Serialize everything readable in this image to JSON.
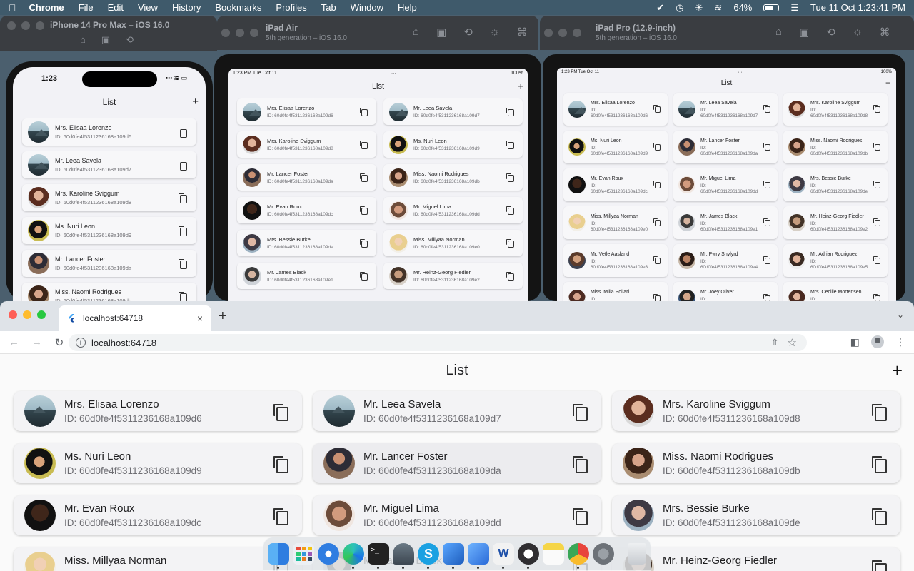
{
  "menubar": {
    "apple": "",
    "items": [
      "Chrome",
      "File",
      "Edit",
      "View",
      "History",
      "Bookmarks",
      "Profiles",
      "Tab",
      "Window",
      "Help"
    ],
    "battery": "64%",
    "datetime": "Tue 11 Oct  1:23:41 PM"
  },
  "simulators": {
    "iphone": {
      "name": "iPhone 14 Pro Max – iOS 16.0",
      "time": "1:23",
      "title": "List",
      "add": "+"
    },
    "ipad_air": {
      "name": "iPad Air",
      "sub": "5th generation – iOS 16.0",
      "time": "1:23 PM  Tue Oct 11",
      "battery": "100%",
      "title": "List",
      "add": "+"
    },
    "ipad_pro": {
      "name": "iPad Pro (12.9-inch)",
      "sub": "5th generation – iOS 16.0",
      "time": "1:23 PM  Tue Oct 11",
      "battery": "100%",
      "title": "List",
      "add": "+"
    }
  },
  "browser": {
    "tab_title": "localhost:64718",
    "tab_close": "×",
    "new_tab": "+",
    "url": "localhost:64718",
    "back": "←",
    "forward": "→",
    "reload": "↻"
  },
  "app": {
    "title": "List",
    "add_label": "+"
  },
  "people": [
    {
      "name": "Mrs. Elisaa Lorenzo",
      "id": "ID: 60d0fe4f5311236168a109d6",
      "avatar": "mountain-photo"
    },
    {
      "name": "Mr. Leea Savela",
      "id": "ID: 60d0fe4f5311236168a109d7",
      "avatar": "mountain-photo"
    },
    {
      "name": "Mrs. Karoline Sviggum",
      "id": "ID: 60d0fe4f5311236168a109d8",
      "avatar": "person-photo"
    },
    {
      "name": "Ms. Nuri Leon",
      "id": "ID: 60d0fe4f5311236168a109d9",
      "avatar": "person-photo"
    },
    {
      "name": "Mr. Lancer Foster",
      "id": "ID: 60d0fe4f5311236168a109da",
      "avatar": "person-photo"
    },
    {
      "name": "Miss. Naomi Rodrigues",
      "id": "ID: 60d0fe4f5311236168a109db",
      "avatar": "person-photo"
    },
    {
      "name": "Mr. Evan Roux",
      "id": "ID: 60d0fe4f5311236168a109dc",
      "avatar": "person-photo"
    },
    {
      "name": "Mr. Miguel Lima",
      "id": "ID: 60d0fe4f5311236168a109dd",
      "avatar": "person-photo"
    },
    {
      "name": "Mrs. Bessie Burke",
      "id": "ID: 60d0fe4f5311236168a109de",
      "avatar": "person-photo"
    },
    {
      "name": "Miss. Millyaa Norman",
      "id": "ID: 60d0fe4f5311236168a109e0",
      "avatar": "person-photo"
    },
    {
      "name": "Mr. James Black",
      "id": "ID: 60d0fe4f5311236168a109e1",
      "avatar": "person-photo"
    },
    {
      "name": "Mr. Heinz-Georg Fiedler",
      "id": "ID: 60d0fe4f5311236168a109e2",
      "avatar": "person-photo"
    },
    {
      "name": "Mr. Vetle Aasland",
      "id": "ID: 60d0fe4f5311236168a109e3",
      "avatar": "person-photo"
    },
    {
      "name": "Mr. Pwry Shylyrd",
      "id": "ID: 60d0fe4f5311236168a109e4",
      "avatar": "person-photo"
    },
    {
      "name": "Mr. Adrian Rodriguez",
      "id": "ID: 60d0fe4f5311236168a109e5",
      "avatar": "person-photo"
    },
    {
      "name": "Miss. Milla Pollari",
      "id": "ID: 60d0fe4f5311236168a109e6",
      "avatar": "person-photo"
    },
    {
      "name": "Mr. Joey Oliver",
      "id": "ID: 60d0fe4f5311236168a109e7",
      "avatar": "person-photo"
    },
    {
      "name": "Mrs. Cecilie Mortensen",
      "id": "ID: 60d0fe4f5311236168a109e8",
      "avatar": "person-photo"
    }
  ],
  "dock": {
    "apps": [
      "finder-icon",
      "launchpad-icon",
      "safari-icon",
      "edge-icon",
      "terminal-icon",
      "tunnel-icon",
      "skype-icon",
      "xcode-icon",
      "xcode-simulator-icon",
      "word-icon",
      "obs-icon",
      "notes-icon",
      "chrome-icon",
      "system-preferences-icon",
      "trash-icon"
    ],
    "colors": {
      "finder": "#3a8ee6",
      "safari": "#2f7de1",
      "chrome": "#e8453c",
      "notes": "#f5d547",
      "terminal": "#222222"
    }
  }
}
